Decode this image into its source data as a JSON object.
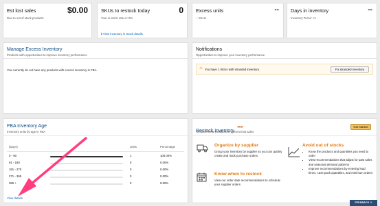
{
  "est_lost_sales": {
    "title": "Est lost sales",
    "value": "$0.00",
    "subtitle": "Due to out of stock products"
  },
  "skus_restock": {
    "title": "SKUs to restock today",
    "value": "0",
    "subtitle": "Your in-stock rate is: 0%",
    "link": "View inventory in Stock details"
  },
  "excess_units": {
    "title": "Excess units",
    "value": "--",
    "subtitle": "-- SKUs"
  },
  "days_in_inventory": {
    "title": "Days in inventory",
    "value": "--",
    "subtitle": "Inventory Turns: <1"
  },
  "manage_excess": {
    "title": "Manage Excess Inventory",
    "subtitle": "Products with opportunities to improve inventory performance",
    "message": "You currently do not have any products with excess inventory in FBA."
  },
  "notifications": {
    "title": "Notifications",
    "subtitle": "Opportunities to improve your inventory performance",
    "alert": "You have 1 SKUs with stranded inventory.",
    "button": "Fix stranded inventory"
  },
  "inventory_age": {
    "title": "FBA Inventory Age",
    "subtitle": "Inventory units by age in FBA",
    "columns": {
      "days": "(Days)",
      "units": "Units",
      "percentage": "Percentage"
    },
    "rows": [
      {
        "days": "0 - 90",
        "units": "1",
        "percentage": "100.00%",
        "fraction": 1.0
      },
      {
        "days": "91 - 180",
        "units": "0",
        "percentage": "0.00%",
        "fraction": 0
      },
      {
        "days": "181 - 270",
        "units": "0",
        "percentage": "0.00%",
        "fraction": 0
      },
      {
        "days": "271 - 365",
        "units": "0",
        "percentage": "0.00%",
        "fraction": 0
      },
      {
        "days": "365 +",
        "units": "0",
        "percentage": "0.00%",
        "fraction": 0
      }
    ],
    "link": "View details"
  },
  "restock": {
    "title": "Restock Inventory",
    "badge": "NEW",
    "subtitle": "Restock these products to prevent lost sales",
    "button": "Get started",
    "organize": {
      "title": "Organize by supplier",
      "text": "Group your inventory by supplier so you can quickly create and track purchase orders"
    },
    "know_when": {
      "title": "Know when to restock",
      "text": "View our order date recommendations to schedule your supplier orders"
    },
    "avoid": {
      "title": "Avoid out of stocks",
      "bullets": [
        "Know the products and quantities you need to order",
        "View recommendations that adjust for past sales and seasonal demand patterns",
        "Improve recommendations by entering lead times, case pack quantities, and minimum orders"
      ]
    }
  },
  "feedback": "FEEDBACK",
  "colors": {
    "accent_orange": "#e47911",
    "link_blue": "#0066c0",
    "arrow_pink": "#ff3d7f"
  }
}
